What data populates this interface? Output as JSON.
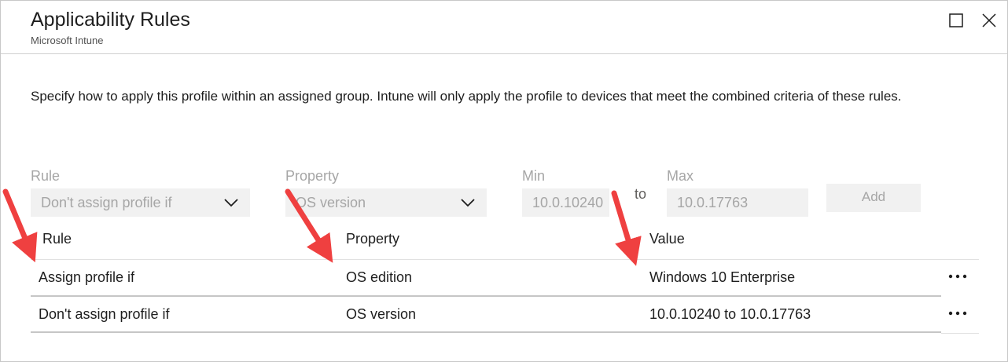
{
  "header": {
    "title": "Applicability Rules",
    "subtitle": "Microsoft Intune",
    "maximize_icon": "maximize-icon",
    "close_icon": "close-icon"
  },
  "description": "Specify how to apply this profile within an assigned group. Intune will only apply the profile to devices that meet the combined criteria of these rules.",
  "form": {
    "rule_label": "Rule",
    "rule_value": "Don't assign profile if",
    "property_label": "Property",
    "property_value": "OS version",
    "min_label": "Min",
    "min_value": "10.0.10240",
    "to_text": "to",
    "max_label": "Max",
    "max_value": "10.0.17763",
    "add_label": "Add"
  },
  "table": {
    "columns": [
      "Rule",
      "Property",
      "Value"
    ],
    "rows": [
      {
        "rule": "Assign profile if",
        "property": "OS edition",
        "value": "Windows 10 Enterprise"
      },
      {
        "rule": "Don't assign profile if",
        "property": "OS version",
        "value": "10.0.10240 to 10.0.17763"
      }
    ]
  },
  "colors": {
    "annotation_arrow": "#ef4040",
    "disabled_text": "#a6a6a6",
    "disabled_bg": "#f1f1f1"
  }
}
